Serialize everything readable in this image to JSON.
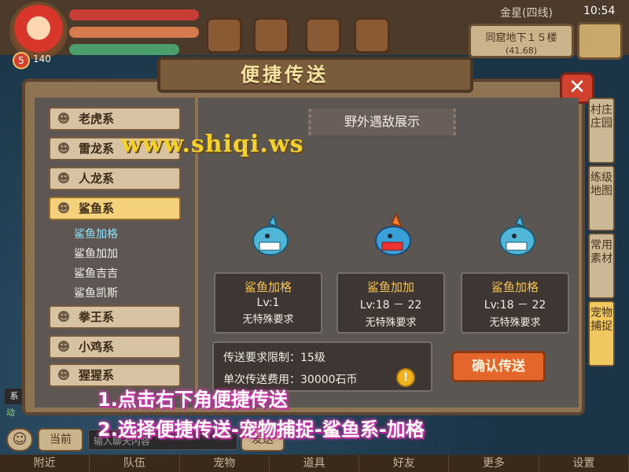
{
  "hud": {
    "level": "5",
    "exp_value": "140",
    "server": "金星(四线)",
    "time": "10:54",
    "location_name": "同窟地下１５楼",
    "location_coord": "(41.68)"
  },
  "dialog": {
    "title": "便捷传送",
    "close_label": "✕",
    "categories": [
      {
        "label": "老虎系",
        "icon": "tiger-icon"
      },
      {
        "label": "雷龙系",
        "icon": "thunder-dragon-icon"
      },
      {
        "label": "人龙系",
        "icon": "humandragon-icon"
      },
      {
        "label": "鲨鱼系",
        "icon": "shark-icon",
        "active": true
      },
      {
        "label": "拳王系",
        "icon": "boxer-icon"
      },
      {
        "label": "小鸡系",
        "icon": "chick-icon"
      },
      {
        "label": "猩猩系",
        "icon": "ape-icon"
      }
    ],
    "subitems": [
      "鲨鱼加格",
      "鲨鱼加加",
      "鲨鱼吉吉",
      "鲨鱼凯斯"
    ],
    "field_tag": "野外遇敌展示",
    "enemies": [
      {
        "name": "鲨鱼加格",
        "level": "Lv:1",
        "requirement": "无特殊要求"
      },
      {
        "name": "鲨鱼加加",
        "level": "Lv:18 － 22",
        "requirement": "无特殊要求"
      },
      {
        "name": "鲨鱼加格",
        "level": "Lv:18 － 22",
        "requirement": "无特殊要求"
      }
    ],
    "req_limit": "传送要求限制：15级",
    "cost": "单次传送费用：30000石币",
    "coin_symbol": "!",
    "confirm_label": "确认传送",
    "side_tabs": [
      "村庄庄园",
      "练级地图",
      "常用素材",
      "宠物捕捉"
    ]
  },
  "watermark": "www.shiqi.ws",
  "instructions": [
    "1.点击右下角便捷传送",
    "2.选择便捷传送-宠物捕捉-鲨鱼系-加格"
  ],
  "chat": {
    "side_label": "系",
    "sub_text": "动",
    "emoji": "☺",
    "channel_label": "当前",
    "input_placeholder": "输入聊天内容",
    "send_label": "发送"
  },
  "menu": [
    "附近",
    "队伍",
    "宠物",
    "道具",
    "好友",
    "更多",
    "设置"
  ],
  "colors": {
    "panel": "#8e7453",
    "accent": "#e5662b",
    "active_category": "#f4d17a",
    "active_subitem": "#8fe4ff",
    "instruction_glow": "#d93fb8"
  }
}
